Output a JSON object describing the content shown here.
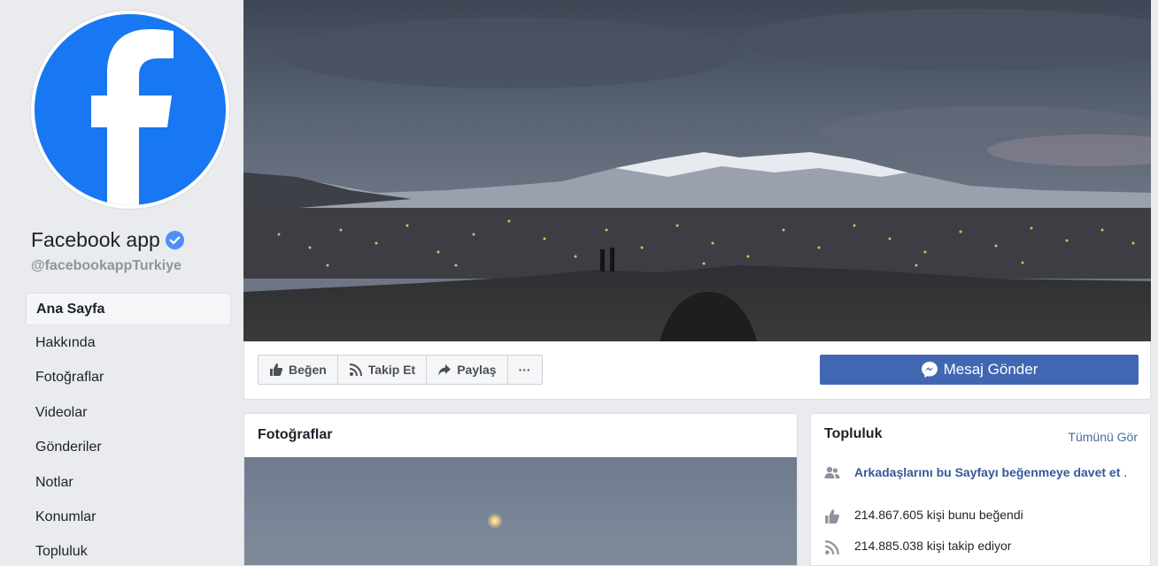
{
  "page": {
    "name": "Facebook app",
    "handle": "@facebookappTurkiye"
  },
  "nav": {
    "items": [
      "Ana Sayfa",
      "Hakkında",
      "Fotoğraflar",
      "Videolar",
      "Gönderiler",
      "Notlar",
      "Konumlar",
      "Topluluk"
    ]
  },
  "actions": {
    "like": "Beğen",
    "follow": "Takip Et",
    "share": "Paylaş",
    "more": "···",
    "message": "Mesaj Gönder"
  },
  "photos": {
    "title": "Fotoğraflar"
  },
  "community": {
    "title": "Topluluk",
    "see_all": "Tümünü Gör",
    "invite": "Arkadaşlarını bu Sayfayı beğenmeye davet et",
    "invite_suffix": ".",
    "likes": "214.867.605 kişi bunu beğendi",
    "follows": "214.885.038 kişi takip ediyor"
  },
  "colors": {
    "brand_blue": "#1877f2",
    "button_blue": "#4267b2",
    "link_blue": "#365899",
    "background": "#e9ebee"
  }
}
